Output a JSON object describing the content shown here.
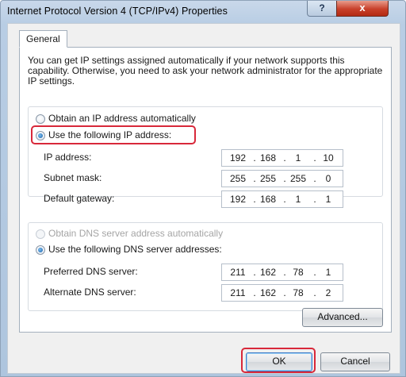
{
  "window": {
    "title": "Internet Protocol Version 4 (TCP/IPv4) Properties",
    "help_label": "?",
    "close_label": "x"
  },
  "tabs": [
    {
      "label": "General"
    }
  ],
  "description": "You can get IP settings assigned automatically if your network supports this capability. Otherwise, you need to ask your network administrator for the appropriate IP settings.",
  "ip": {
    "auto_label": "Obtain an IP address automatically",
    "manual_label": "Use the following IP address:",
    "selected": "manual",
    "fields": [
      {
        "label": "IP address:",
        "octets": [
          "192",
          "168",
          "1",
          "10"
        ]
      },
      {
        "label": "Subnet mask:",
        "octets": [
          "255",
          "255",
          "255",
          "0"
        ]
      },
      {
        "label": "Default gateway:",
        "octets": [
          "192",
          "168",
          "1",
          "1"
        ]
      }
    ]
  },
  "dns": {
    "auto_label": "Obtain DNS server address automatically",
    "manual_label": "Use the following DNS server addresses:",
    "selected": "manual",
    "auto_disabled": true,
    "fields": [
      {
        "label": "Preferred DNS server:",
        "octets": [
          "211",
          "162",
          "78",
          "1"
        ]
      },
      {
        "label": "Alternate DNS server:",
        "octets": [
          "211",
          "162",
          "78",
          "2"
        ]
      }
    ]
  },
  "buttons": {
    "advanced": "Advanced...",
    "ok": "OK",
    "cancel": "Cancel"
  },
  "colors": {
    "highlight": "#d8283a",
    "title_bar": "#b8cde4",
    "close_button": "#c8402a"
  }
}
